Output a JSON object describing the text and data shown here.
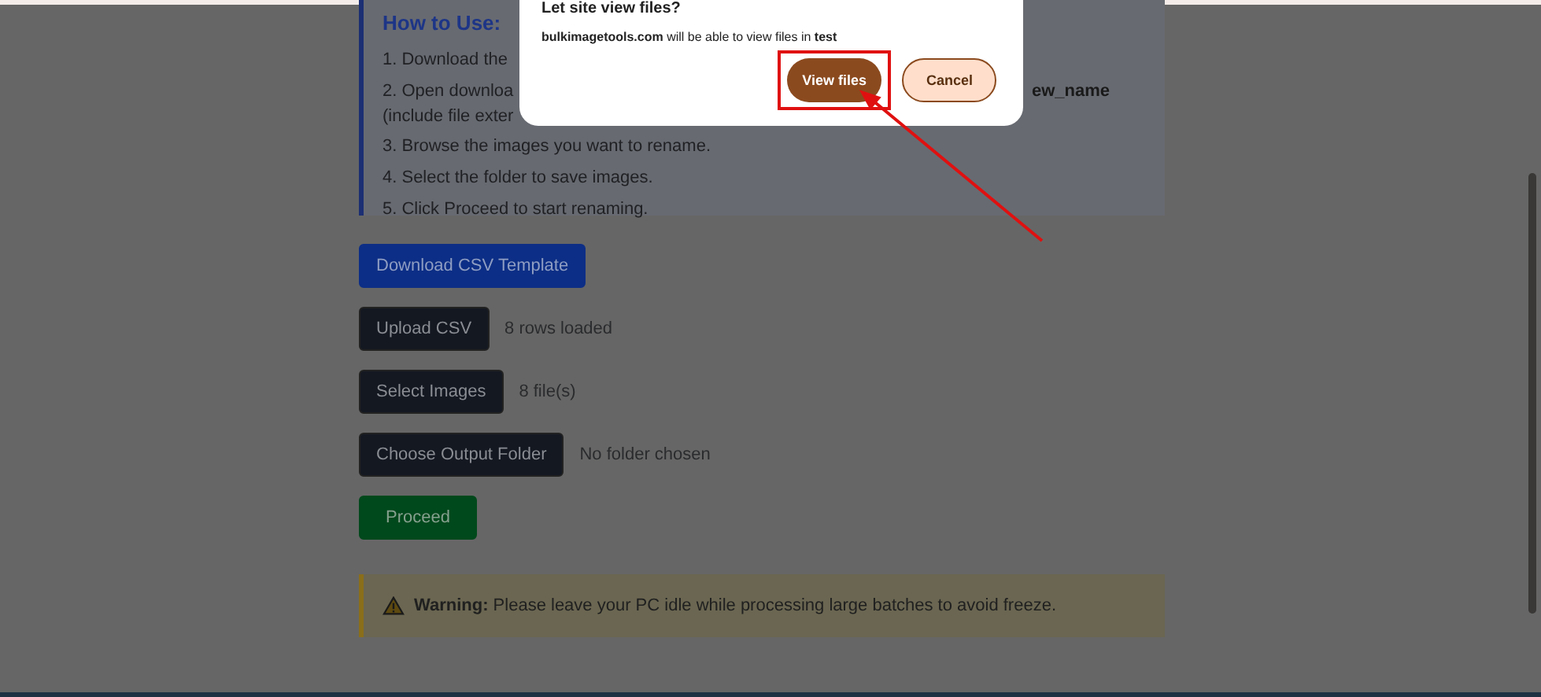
{
  "instructions": {
    "heading": "How to Use:",
    "lines": [
      {
        "text": "1. Download the"
      },
      {
        "text": "2. Open downloa",
        "tail": "ew_name"
      },
      {
        "text": "(include file exter"
      },
      {
        "text": "3. Browse the images you want to rename."
      },
      {
        "text": "4. Select the folder to save images."
      },
      {
        "text": "5. Click Proceed to start renaming."
      }
    ]
  },
  "actions": [
    {
      "kind": "primary",
      "label": "Download CSV Template"
    },
    {
      "kind": "dark",
      "label": "Upload CSV",
      "status": "8 rows loaded"
    },
    {
      "kind": "dark",
      "label": "Select Images",
      "status": "8 file(s)"
    },
    {
      "kind": "dark",
      "label": "Choose Output Folder",
      "status": "No folder chosen"
    },
    {
      "kind": "success",
      "label": "Proceed"
    }
  ],
  "warning": {
    "text": "**Warning:** Please leave your PC idle while processing large batches to avoid freeze."
  },
  "dialog": {
    "title": "Let site view files?",
    "message": "**bulkimagetools.com** will be able to view files in **test**",
    "buttons": [
      {
        "kind": "confirm",
        "label": "View files",
        "highlighted": true
      },
      {
        "kind": "cancel",
        "label": "Cancel",
        "highlighted": false
      }
    ]
  }
}
